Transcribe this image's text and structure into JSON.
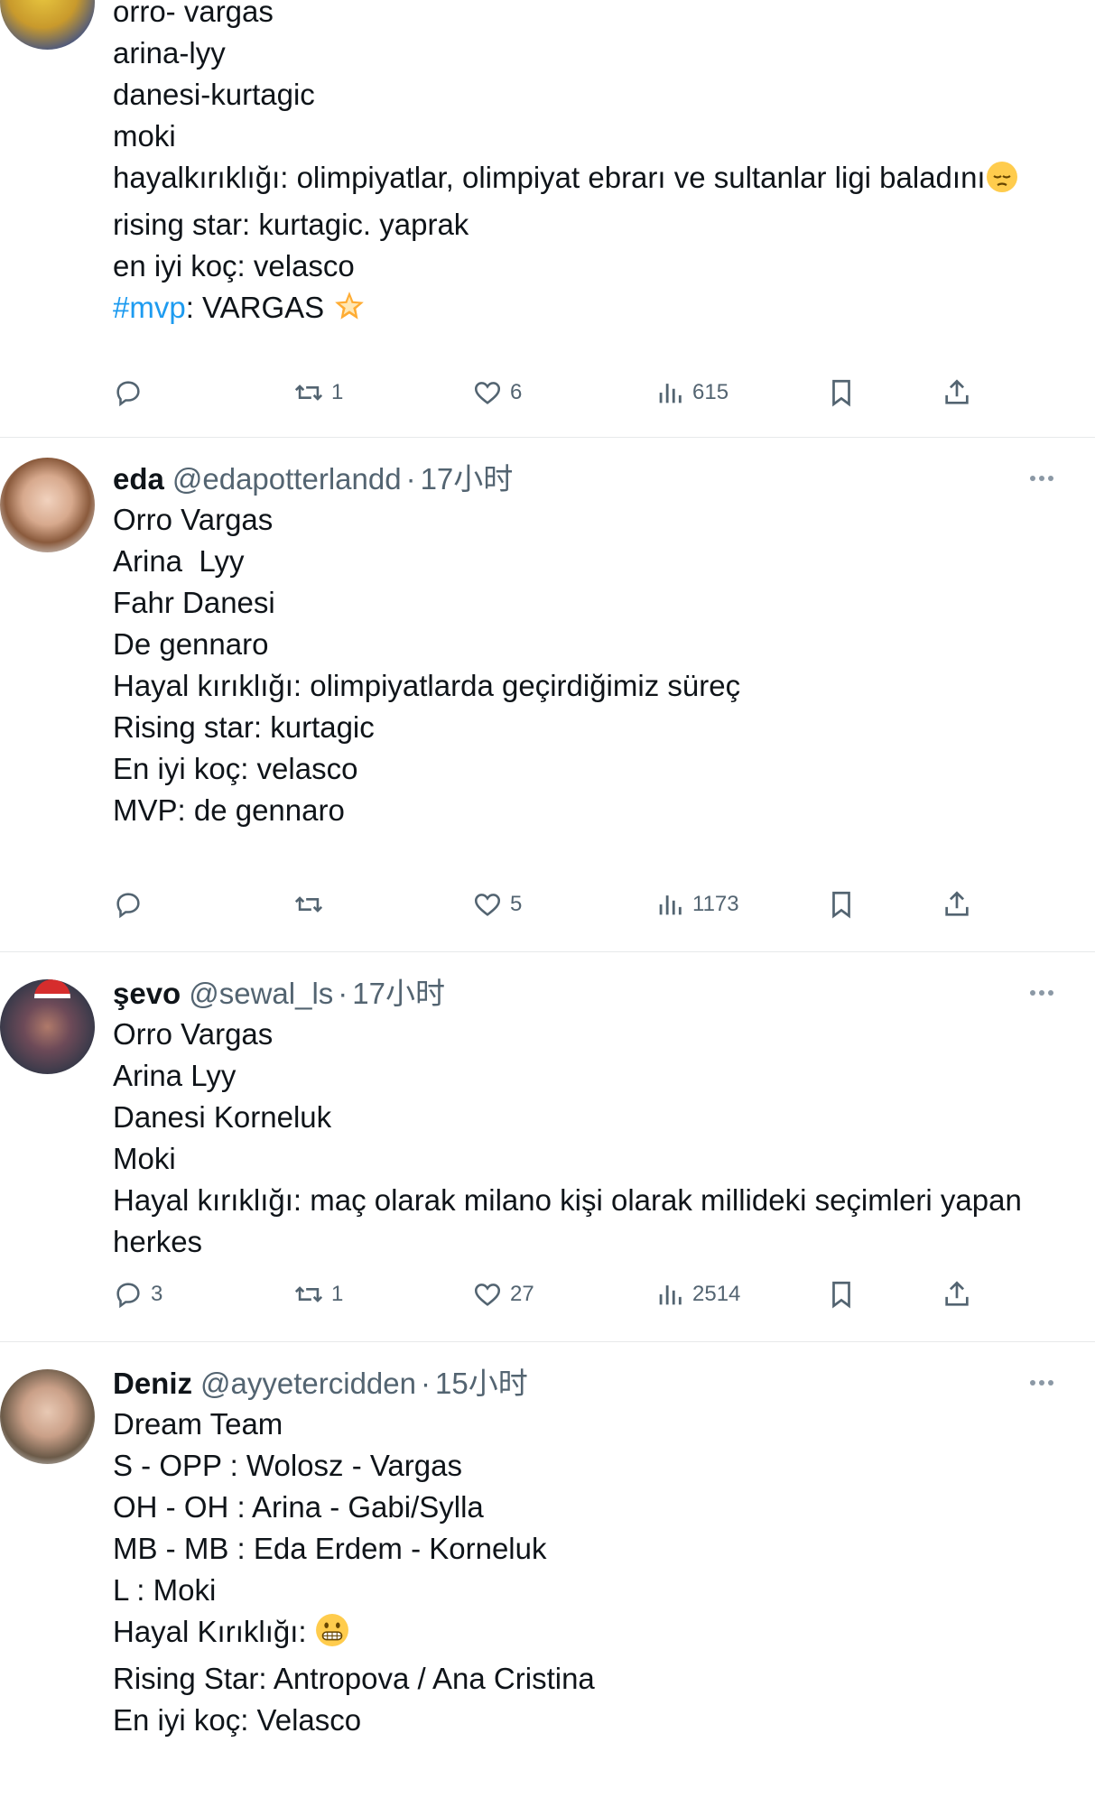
{
  "tweets": [
    {
      "lines": [
        "orro- vargas",
        "arina-lyy",
        "danesi-kurtagic",
        "moki",
        "",
        "hayalkırıklığı: olimpiyatlar, olimpiyat ebrarı ve sultanlar ligi baladını",
        "rising star: kurtagic. yaprak",
        "en iyi koç: velasco"
      ],
      "hashtag": "#mvp",
      "last_line_rest": ": VARGAS",
      "replies": "",
      "retweets": "1",
      "likes": "6",
      "views": "615"
    },
    {
      "name": "eda",
      "handle": "@edapotterlandd",
      "dot": "·",
      "time": "17小时",
      "lines": [
        "Orro Vargas",
        "Arina  Lyy",
        "Fahr Danesi",
        "De gennaro",
        "",
        "Hayal kırıklığı: olimpiyatlarda geçirdiğimiz süreç",
        "Rising star: kurtagic",
        "En iyi koç: velasco",
        "MVP: de gennaro"
      ],
      "replies": "",
      "retweets": "",
      "likes": "5",
      "views": "1173"
    },
    {
      "name": "şevo",
      "handle": "@sewal_ls",
      "dot": "·",
      "time": "17小时",
      "lines": [
        "Orro Vargas",
        "Arina Lyy",
        "Danesi Korneluk",
        "Moki",
        "Hayal kırıklığı: maç olarak milano kişi olarak millideki seçimleri yapan",
        "herkes"
      ],
      "replies": "3",
      "retweets": "1",
      "likes": "27",
      "views": "2514"
    },
    {
      "name": "Deniz",
      "handle": "@ayyetercidden",
      "dot": "·",
      "time": "15小时",
      "lines": [
        "Dream Team",
        "S - OPP : Wolosz - Vargas",
        "OH - OH : Arina - Gabi/Sylla",
        "MB - MB : Eda Erdem - Korneluk",
        "L : Moki",
        "",
        "Hayal Kırıklığı:",
        "Rising Star: Antropova / Ana Cristina",
        "En iyi koç: Velasco"
      ]
    }
  ],
  "icons": {
    "reply": "reply-icon",
    "retweet": "retweet-icon",
    "like": "heart-icon",
    "views": "views-chart-icon",
    "bookmark": "bookmark-icon",
    "share": "share-icon",
    "more": "more-dots-icon"
  },
  "colors": {
    "text": "#0f1419",
    "secondary": "#536471",
    "accent": "#1d9bf0"
  }
}
